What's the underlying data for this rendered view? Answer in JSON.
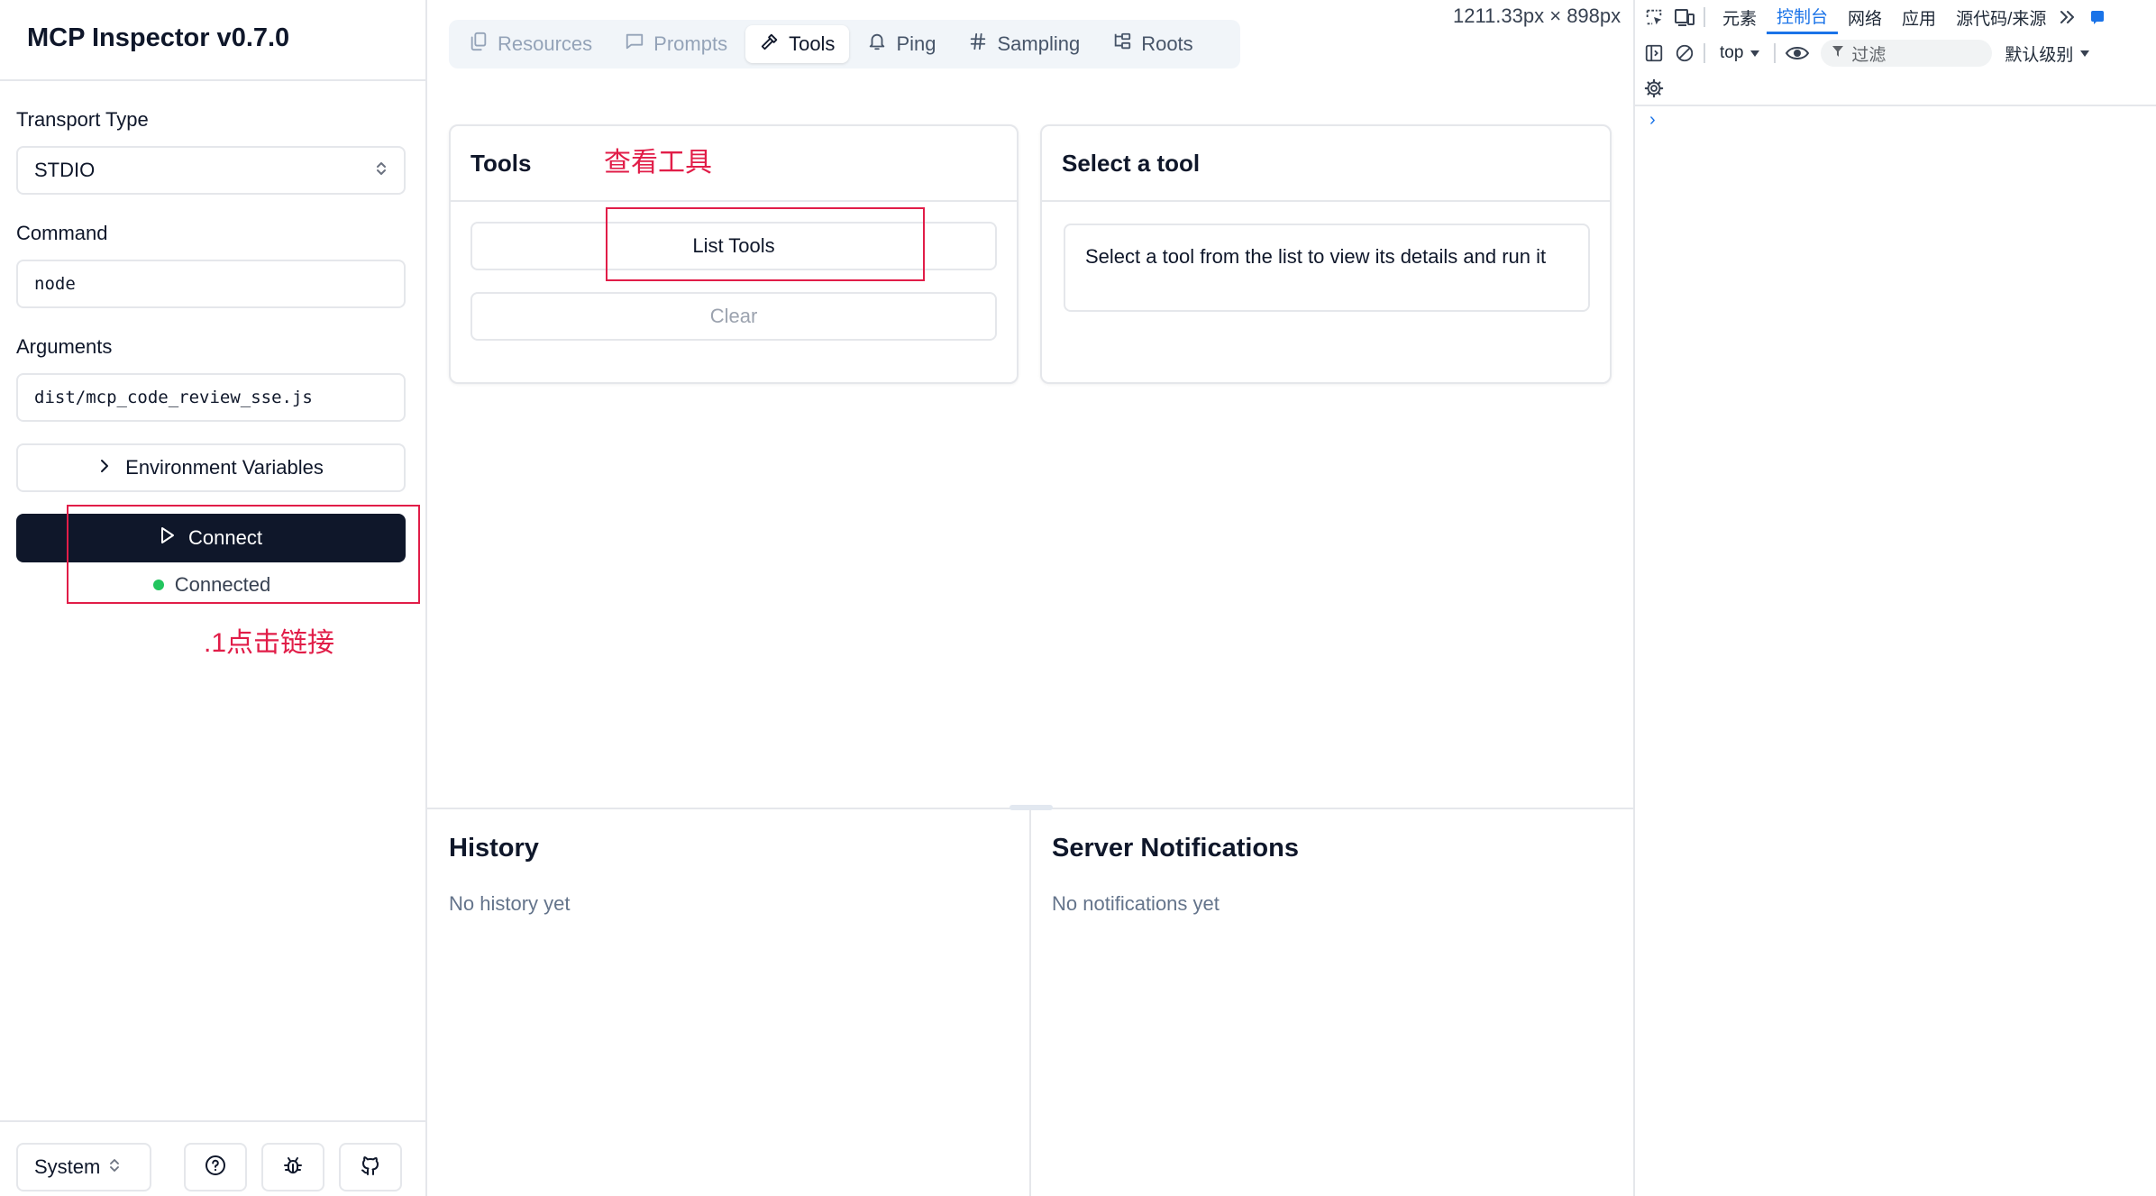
{
  "app": {
    "title": "MCP Inspector v0.7.0"
  },
  "sidebar": {
    "transport_label": "Transport Type",
    "transport_value": "STDIO",
    "command_label": "Command",
    "command_value": "node",
    "arguments_label": "Arguments",
    "arguments_value": "dist/mcp_code_review_sse.js",
    "env_label": "Environment Variables",
    "connect_label": "Connect",
    "status_text": "Connected",
    "theme_value": "System"
  },
  "tabs": [
    {
      "label": "Resources",
      "icon": "files-icon"
    },
    {
      "label": "Prompts",
      "icon": "message-square-icon"
    },
    {
      "label": "Tools",
      "icon": "hammer-icon"
    },
    {
      "label": "Ping",
      "icon": "bell-icon"
    },
    {
      "label": "Sampling",
      "icon": "hash-icon"
    },
    {
      "label": "Roots",
      "icon": "folder-tree-icon"
    }
  ],
  "active_tab": "Tools",
  "viewport_readout": "1211.33px × 898px",
  "tools_panel": {
    "title": "Tools",
    "list_button": "List Tools",
    "clear_button": "Clear"
  },
  "detail_panel": {
    "title": "Select a tool",
    "message": "Select a tool from the list to view its details and run it"
  },
  "history": {
    "title": "History",
    "empty": "No history yet"
  },
  "notifications": {
    "title": "Server Notifications",
    "empty": "No notifications yet"
  },
  "annotations": {
    "step1": ".1点击链接",
    "step2": "查看工具"
  },
  "devtools": {
    "tabs": [
      "元素",
      "控制台",
      "网络",
      "应用",
      "源代码/来源"
    ],
    "active_tab": "控制台",
    "context": "top",
    "filter_placeholder": "过滤",
    "level": "默认级别",
    "prompt": "›"
  },
  "colors": {
    "primary": "#0f172a",
    "connected": "#22c55e",
    "annotation": "#e11d48",
    "devtools_accent": "#1a73e8"
  }
}
